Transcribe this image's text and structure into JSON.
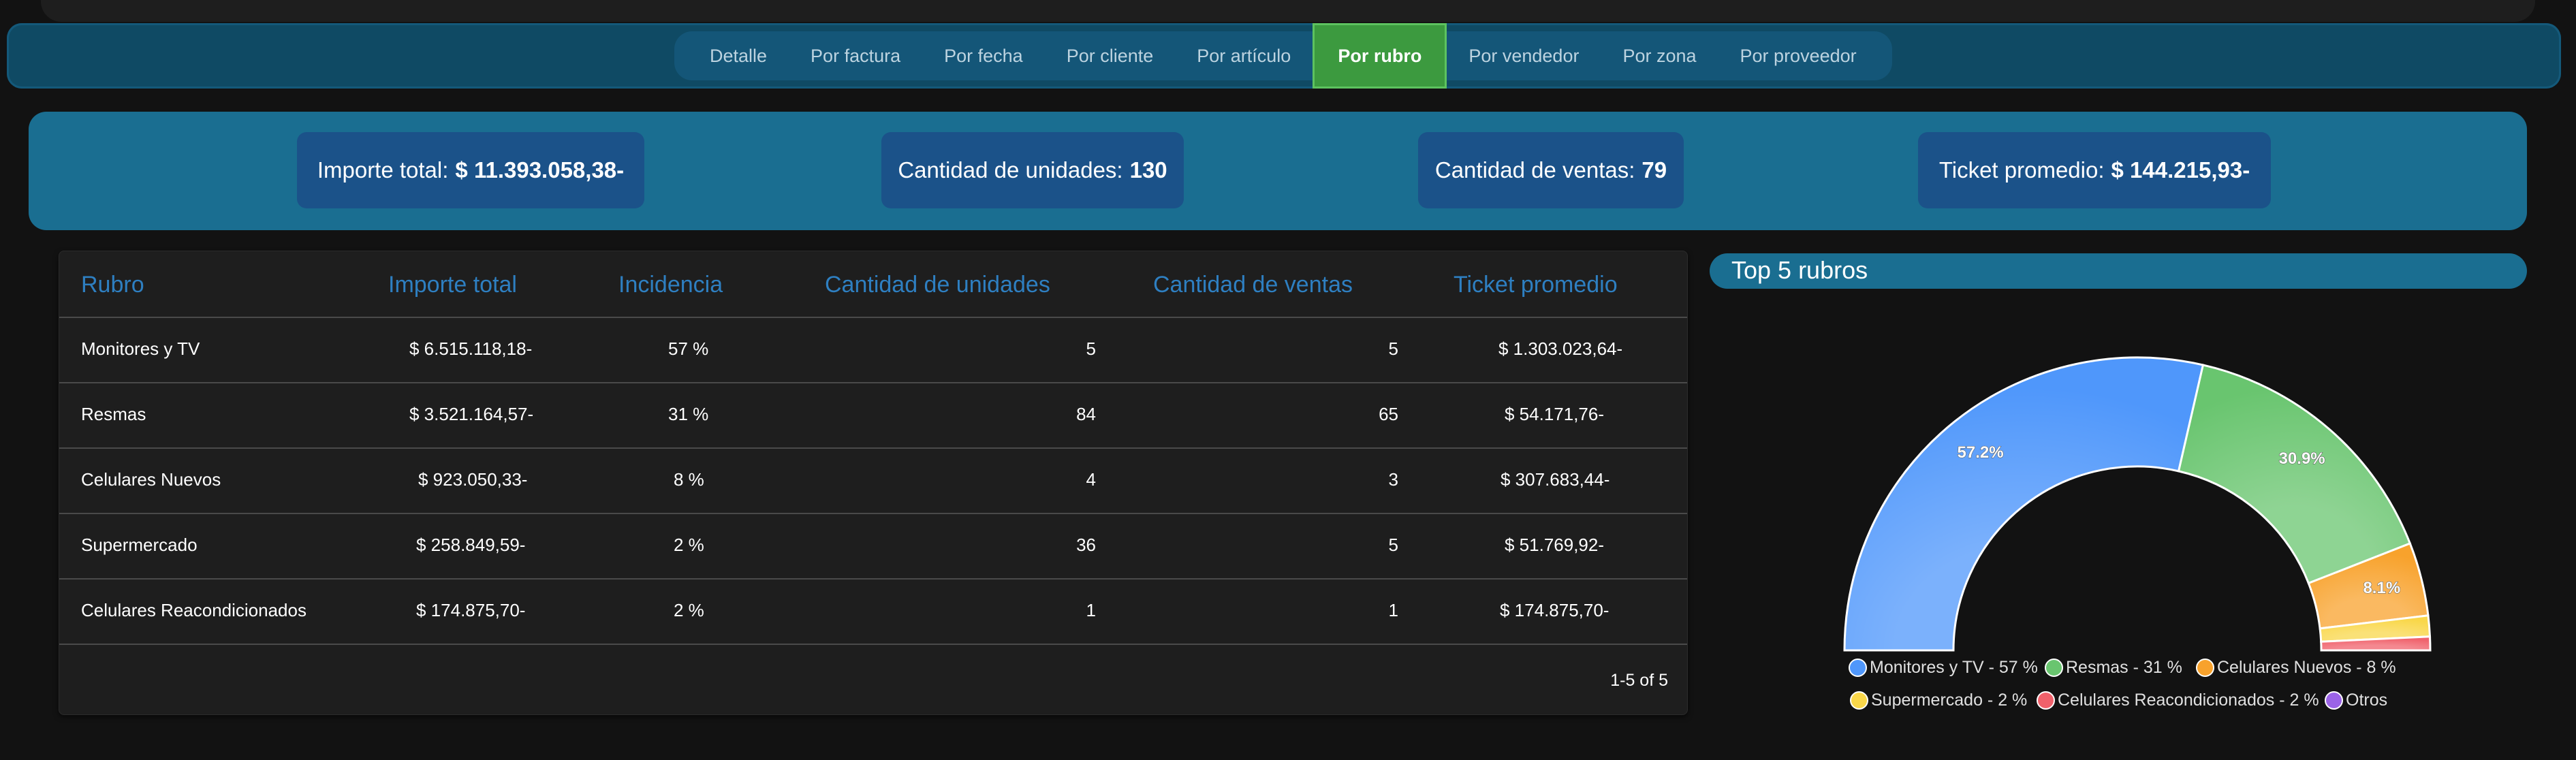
{
  "tabs": [
    {
      "label": "Detalle"
    },
    {
      "label": "Por factura"
    },
    {
      "label": "Por fecha"
    },
    {
      "label": "Por cliente"
    },
    {
      "label": "Por artículo"
    },
    {
      "label": "Por rubro",
      "active": true
    },
    {
      "label": "Por vendedor"
    },
    {
      "label": "Por zona"
    },
    {
      "label": "Por proveedor"
    }
  ],
  "summary": {
    "importe_label": "Importe total:",
    "importe_value": "$ 11.393.058,38-",
    "unidades_label": "Cantidad de unidades:",
    "unidades_value": "130",
    "ventas_label": "Cantidad de ventas:",
    "ventas_value": "79",
    "ticket_label": "Ticket promedio:",
    "ticket_value": "$ 144.215,93-"
  },
  "table": {
    "headers": [
      "Rubro",
      "Importe total",
      "Incidencia",
      "Cantidad de unidades",
      "Cantidad de ventas",
      "Ticket promedio"
    ],
    "rows": [
      [
        "Monitores y TV",
        "$ 6.515.118,18-",
        "57 %",
        "5",
        "5",
        "$ 1.303.023,64-"
      ],
      [
        "Resmas",
        "$ 3.521.164,57-",
        "31 %",
        "84",
        "65",
        "$ 54.171,76-"
      ],
      [
        "Celulares Nuevos",
        "$ 923.050,33-",
        "8 %",
        "4",
        "3",
        "$ 307.683,44-"
      ],
      [
        "Supermercado",
        "$ 258.849,59-",
        "2 %",
        "36",
        "5",
        "$ 51.769,92-"
      ],
      [
        "Celulares Reacondicionados",
        "$ 174.875,70-",
        "2 %",
        "1",
        "1",
        "$ 174.875,70-"
      ]
    ],
    "pagination": "1-5 of 5"
  },
  "chart_data": {
    "type": "pie",
    "title": "Top 5 rubros",
    "semi_circle": true,
    "slices": [
      {
        "name": "Monitores y TV - 57 %",
        "value": 57.2,
        "label": "57.2%",
        "color": "#4f97fb"
      },
      {
        "name": "Resmas - 31 %",
        "value": 30.9,
        "label": "30.9%",
        "color": "#69c56f"
      },
      {
        "name": "Celulares Nuevos - 8 %",
        "value": 8.1,
        "label": "8.1%",
        "color": "#f8a22c"
      },
      {
        "name": "Supermercado - 2 %",
        "value": 2.3,
        "label": "",
        "color": "#f9d74a"
      },
      {
        "name": "Celulares Reacondicionados - 2 %",
        "value": 1.5,
        "label": "",
        "color": "#f0616b"
      },
      {
        "name": "Otros",
        "value": 0,
        "label": "",
        "color": "#9b63e6"
      }
    ],
    "legend_position": "bottom"
  },
  "colors": {
    "accent": "#2e7fc1",
    "active_tab": "#3c9a3f",
    "summary_band": "#1a6e91",
    "summary_card": "#1b5289"
  }
}
